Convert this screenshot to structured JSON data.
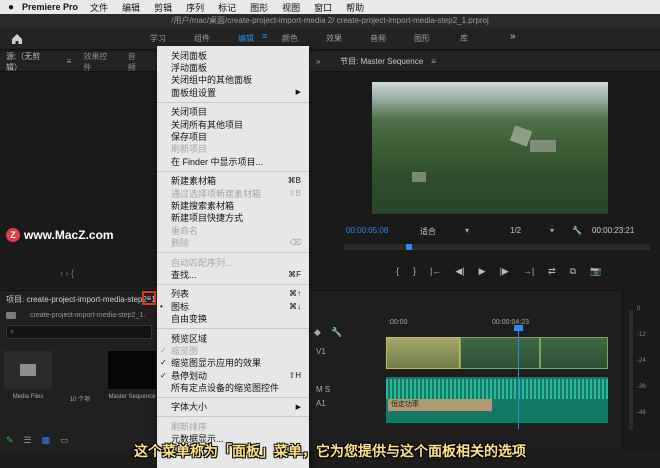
{
  "menubar": {
    "apple": "",
    "app_name": "Premiere Pro",
    "items": [
      "文件",
      "编辑",
      "剪辑",
      "序列",
      "标记",
      "图形",
      "视图",
      "窗口",
      "帮助"
    ]
  },
  "window_title": "/用户/mac/桌面/create-project-import-media 2/  create-project-import-media-step2_1.prproj",
  "workspace": {
    "tabs": [
      "学习",
      "组件",
      "编辑",
      "颜色",
      "效果",
      "音频",
      "图形",
      "库"
    ],
    "active": "编辑",
    "menu_glyph": "≡",
    "more": "»"
  },
  "source_panel": {
    "tabs": [
      "源:（无剪辑）",
      "效果控件",
      "音频"
    ],
    "menu_glyph": "≡",
    "watermark": "www.MacZ.com",
    "controls": "‹     ›     {"
  },
  "project_panel": {
    "title": "项目: create-project-import-media-step2_1",
    "path": "create-project-import-media-step2_1.",
    "search_icon": "⌕",
    "bins": [
      {
        "label": "Media Files",
        "type": "folder"
      },
      {
        "label": "10 个项",
        "type": "count"
      },
      {
        "label": "Master Sequence",
        "type": "sequence"
      }
    ]
  },
  "panel_menu": {
    "items": [
      {
        "label": "关闭面板",
        "type": "item"
      },
      {
        "label": "浮动面板",
        "type": "item"
      },
      {
        "label": "关闭组中的其他面板",
        "type": "item"
      },
      {
        "label": "面板组设置",
        "type": "submenu"
      },
      {
        "type": "sep"
      },
      {
        "label": "关闭项目",
        "type": "item"
      },
      {
        "label": "关闭所有其他项目",
        "type": "item"
      },
      {
        "label": "保存项目",
        "type": "item"
      },
      {
        "label": "刷新项目",
        "type": "disabled"
      },
      {
        "label": "在 Finder 中显示项目...",
        "type": "item"
      },
      {
        "type": "sep"
      },
      {
        "label": "新建素材箱",
        "type": "item",
        "shortcut": "⌘B"
      },
      {
        "label": "通过选择项新建素材箱",
        "type": "disabled",
        "shortcut": "⇧B"
      },
      {
        "label": "新建搜索素材箱",
        "type": "item"
      },
      {
        "label": "新建项目快捷方式",
        "type": "item"
      },
      {
        "label": "重命名",
        "type": "disabled"
      },
      {
        "label": "删除",
        "type": "disabled",
        "shortcut": "⌫"
      },
      {
        "type": "sep"
      },
      {
        "label": "自动匹配序列...",
        "type": "disabled"
      },
      {
        "label": "查找...",
        "type": "item",
        "shortcut": "⌘F"
      },
      {
        "type": "sep"
      },
      {
        "label": "列表",
        "type": "item",
        "shortcut": "⌘↑"
      },
      {
        "label": "图标",
        "type": "radio",
        "shortcut": "⌘↓"
      },
      {
        "label": "自由变换",
        "type": "item"
      },
      {
        "type": "sep"
      },
      {
        "label": "预览区域",
        "type": "item"
      },
      {
        "label": "缩览图",
        "type": "disabled-check"
      },
      {
        "label": "缩览图显示应用的效果",
        "type": "check"
      },
      {
        "label": "悬停划动",
        "type": "check",
        "shortcut": "⇧H"
      },
      {
        "label": "所有定点设备的缩览图控件",
        "type": "item"
      },
      {
        "type": "sep"
      },
      {
        "label": "字体大小",
        "type": "submenu"
      },
      {
        "type": "sep"
      },
      {
        "label": "刷新排序",
        "type": "disabled"
      },
      {
        "label": "元数据显示...",
        "type": "item"
      }
    ],
    "check_glyph": "✓",
    "radio_glyph": "•",
    "submenu_glyph": "▶"
  },
  "program_monitor": {
    "title": "节目: Master Sequence",
    "menu_glyph": "≡",
    "timecode_left": "00:00:05:08",
    "fit": "适合",
    "ratio": "1/2",
    "timecode_right": "00:00:23:21",
    "transport": [
      "{",
      "}",
      "|←",
      "◀|",
      "▶",
      "|▶",
      "→|",
      "⇄",
      "⧉",
      "📷"
    ]
  },
  "timeline": {
    "time0": ":00:00",
    "time1": "00:00:04:23",
    "clip_label": "恒定功率",
    "tracks": [
      "V1",
      "A1"
    ],
    "controls": "M  S"
  },
  "meter": {
    "levels": [
      "0",
      "-12",
      "-24",
      "-36",
      "-48"
    ]
  },
  "caption": "这个菜单称为「面板」菜单，它为您提供与这个面板相关的选项",
  "colors": {
    "accent_blue": "#2d8ceb",
    "highlight_red": "#e0362c",
    "audio_teal": "#147a68",
    "caption_yellow": "#ffe28a"
  }
}
